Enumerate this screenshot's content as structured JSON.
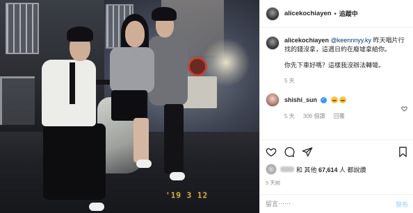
{
  "photo": {
    "date_stamp": "'19 3 12"
  },
  "header": {
    "username": "alicekochiayen",
    "separator": "•",
    "follow_label": "追蹤中"
  },
  "caption": {
    "username": "alicekochiayen",
    "mention": "@keennnyy.ky",
    "text_line1": " 昨天唱片行找的錢沒拿，這週日約在廢墟拿給你。",
    "text_line2": "你先下車好嗎？這樣我沒辦法轉彎。",
    "age": "5 天"
  },
  "comment": {
    "username": "shishi_sun",
    "verified_mark": "✓",
    "emojis": [
      "laughing-tears-emoji",
      "laughing-tears-emoji"
    ],
    "age": "5 天",
    "likes": "306 個讚",
    "reply": "回覆"
  },
  "actions": {
    "like_icon": "heart-icon",
    "comment_icon": "comment-icon",
    "share_icon": "share-icon",
    "save_icon": "bookmark-icon"
  },
  "likes": {
    "prefix": "和 其他 ",
    "count": "67,614",
    "suffix": " 人 都說讚"
  },
  "post_age": "5 天前",
  "add_comment": {
    "placeholder": "留言⋯⋯",
    "post_label": "發布"
  },
  "colors": {
    "link": "#00376b",
    "meta": "#8e8e8e",
    "verified": "#3897f0",
    "post_button": "#b2dffc",
    "date_stamp": "#f3c74c"
  }
}
